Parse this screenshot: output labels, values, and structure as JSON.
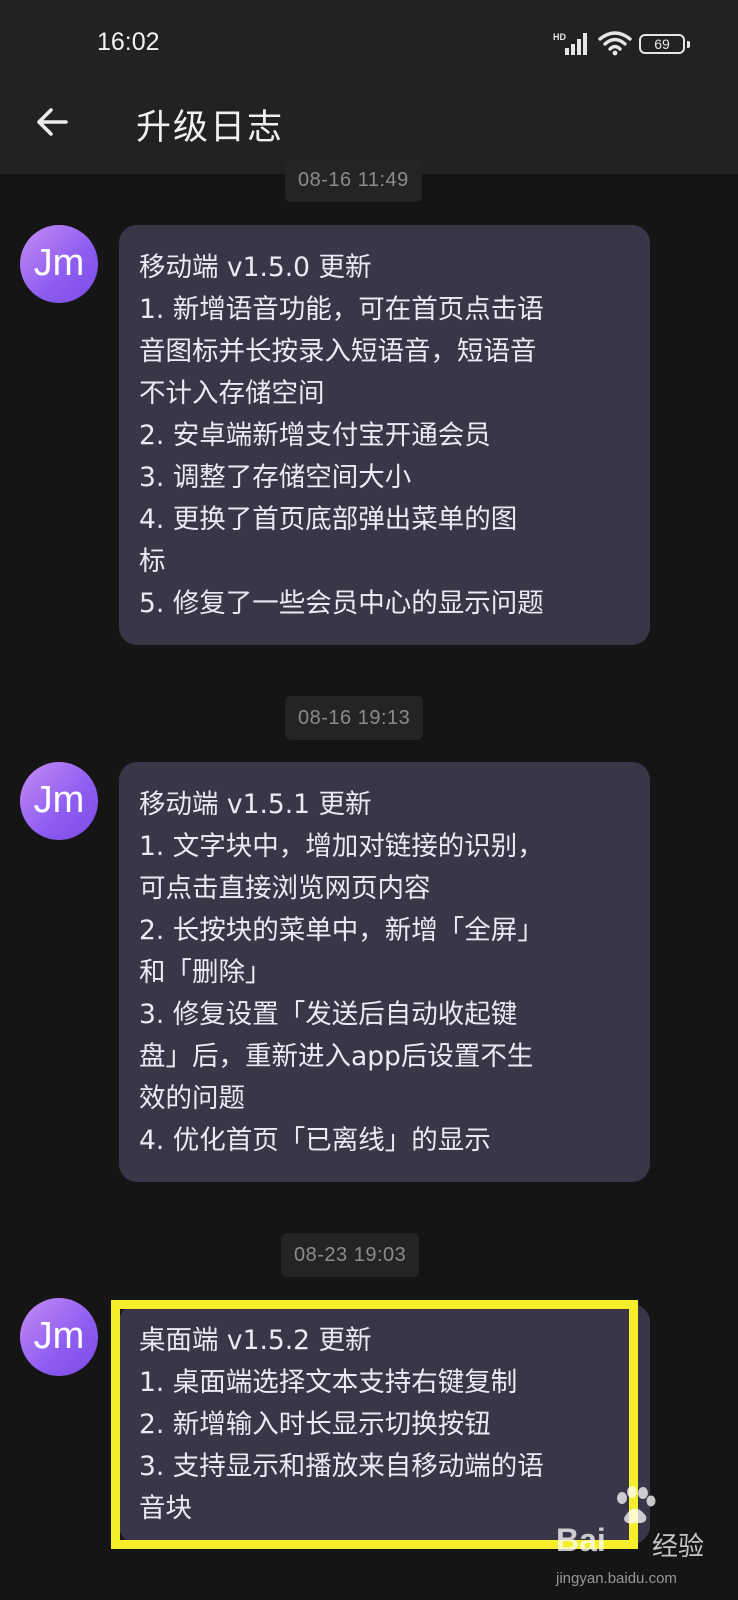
{
  "status_bar": {
    "time": "16:02",
    "network": "HD",
    "battery": "69"
  },
  "app_bar": {
    "title": "升级日志"
  },
  "messages": [
    {
      "timestamp": "08-16 11:49",
      "avatar": "Jm",
      "lines": [
        "移动端 v1.5.0 更新",
        "1. 新增语音功能，可在首页点击语",
        "音图标并长按录入短语音，短语音",
        "不计入存储空间",
        "2. 安卓端新增支付宝开通会员",
        "3. 调整了存储空间大小",
        "4. 更换了首页底部弹出菜单的图",
        "标",
        "5. 修复了一些会员中心的显示问题"
      ]
    },
    {
      "timestamp": "08-16 19:13",
      "avatar": "Jm",
      "lines": [
        "移动端 v1.5.1 更新",
        "1. 文字块中，增加对链接的识别，",
        "可点击直接浏览网页内容",
        "2. 长按块的菜单中，新增「全屏」",
        "和「删除」",
        "3. 修复设置「发送后自动收起键",
        "盘」后，重新进入app后设置不生",
        "效的问题",
        "4. 优化首页「已离线」的显示"
      ]
    },
    {
      "timestamp": "08-23 19:03",
      "avatar": "Jm",
      "lines": [
        "桌面端 v1.5.2 更新",
        "1. 桌面端选择文本支持右键复制",
        "2. 新增输入时长显示切换按钮",
        "3. 支持显示和播放来自移动端的语",
        "音块"
      ]
    }
  ],
  "watermark": {
    "brand": "Bai",
    "suffix": "经验",
    "url": "jingyan.baidu.com"
  },
  "colors": {
    "background": "#151515",
    "bubble": "#3a3647",
    "highlight": "#f4ef2a",
    "avatar": "#8d5cf0"
  }
}
